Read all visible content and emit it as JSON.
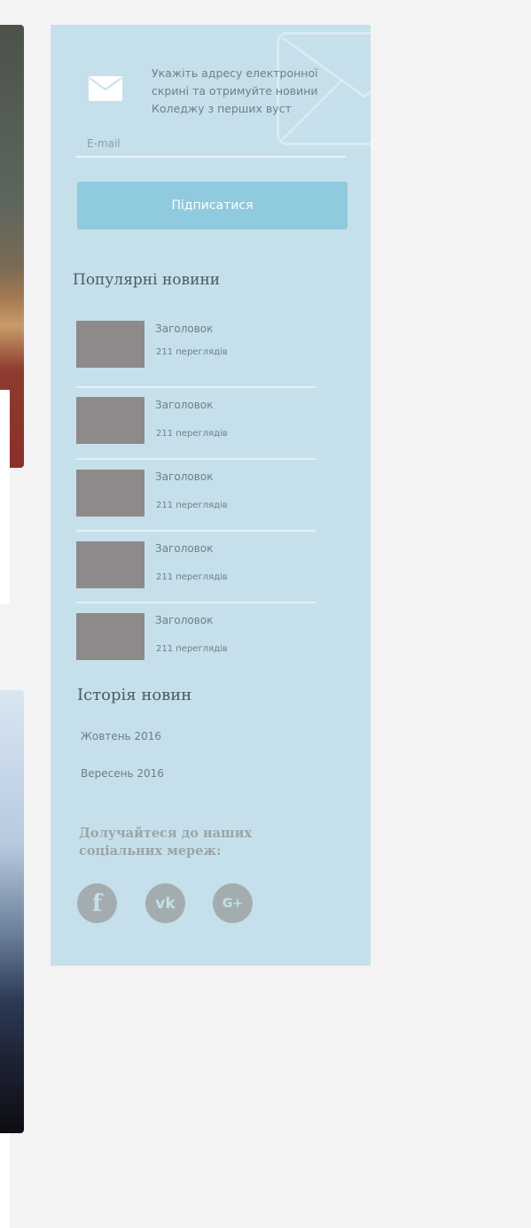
{
  "subscribe": {
    "text": "Укажіть адресу електронної скрині та отримуйте новини Коледжу з перших вуст",
    "email_placeholder": "E-mail",
    "button_label": "Підписатися"
  },
  "popular_news": {
    "title": "Популярні новини",
    "items": [
      {
        "title": "Заголовок",
        "views": "211 переглядів"
      },
      {
        "title": "Заголовок",
        "views": "211 переглядів"
      },
      {
        "title": "Заголовок",
        "views": "211 переглядів"
      },
      {
        "title": "Заголовок",
        "views": "211 переглядів"
      },
      {
        "title": "Заголовок",
        "views": "211 переглядів"
      }
    ]
  },
  "news_history": {
    "title": "Історія новин",
    "items": [
      "Жовтень 2016",
      "Вересень 2016"
    ]
  },
  "social": {
    "title": "Долучайтеся до наших соціальних мереж:",
    "icons": [
      {
        "name": "facebook-icon",
        "glyph": "f"
      },
      {
        "name": "vk-icon",
        "glyph": "vk"
      },
      {
        "name": "google-plus-icon",
        "glyph": "G+"
      }
    ]
  },
  "colors": {
    "sidebar_bg": "#c5e0ea",
    "button_bg": "#8fcade",
    "thumb_placeholder": "#8e8a8a",
    "social_icon_bg": "#a3adb0"
  }
}
